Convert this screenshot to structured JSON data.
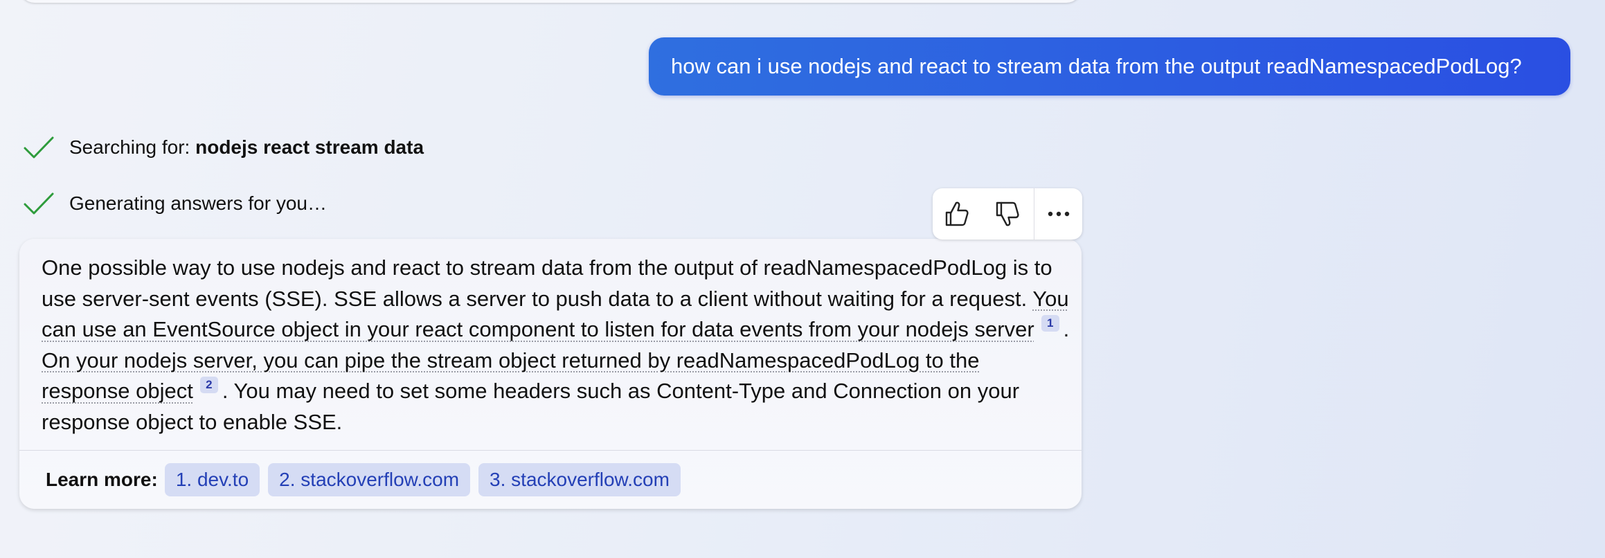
{
  "user_message": {
    "text": "how can i use nodejs and react to stream data from the output readNamespacedPodLog?"
  },
  "progress": [
    {
      "prefix": "Searching for: ",
      "query": "nodejs react stream data",
      "icon": "checkmark-icon",
      "color": "#2e9c3c"
    },
    {
      "prefix": "Generating answers for you…",
      "query": "",
      "icon": "checkmark-icon",
      "color": "#2e9c3c"
    }
  ],
  "feedback": {
    "like_icon": "thumbs-up-icon",
    "dislike_icon": "thumbs-down-icon",
    "more_icon": "more-options-icon"
  },
  "answer": {
    "part1": "One possible way to use nodejs and react to stream data from the output of readNamespacedPodLog is to use server-sent events (SSE). SSE allows a server to push data to a client without waiting for a request. ",
    "cite1_text": "You can use an EventSource object in your react component to listen for data events from your nodejs server",
    "cite1_num": "1",
    "part2": ". ",
    "cite2_text": "On your nodejs server, you can pipe the stream object returned by readNamespacedPodLog to the response object",
    "cite2_num": "2",
    "part3": ". You may need to set some headers such as Content-Type and Connection on your response object to enable SSE."
  },
  "learn_more": {
    "label": "Learn more:",
    "links": [
      "1. dev.to",
      "2. stackoverflow.com",
      "3. stackoverflow.com"
    ]
  },
  "colors": {
    "user_bubble": "#2f5fe0",
    "check": "#2e9c3c",
    "link": "#2440b6",
    "chip_bg": "#d5dcf4"
  }
}
